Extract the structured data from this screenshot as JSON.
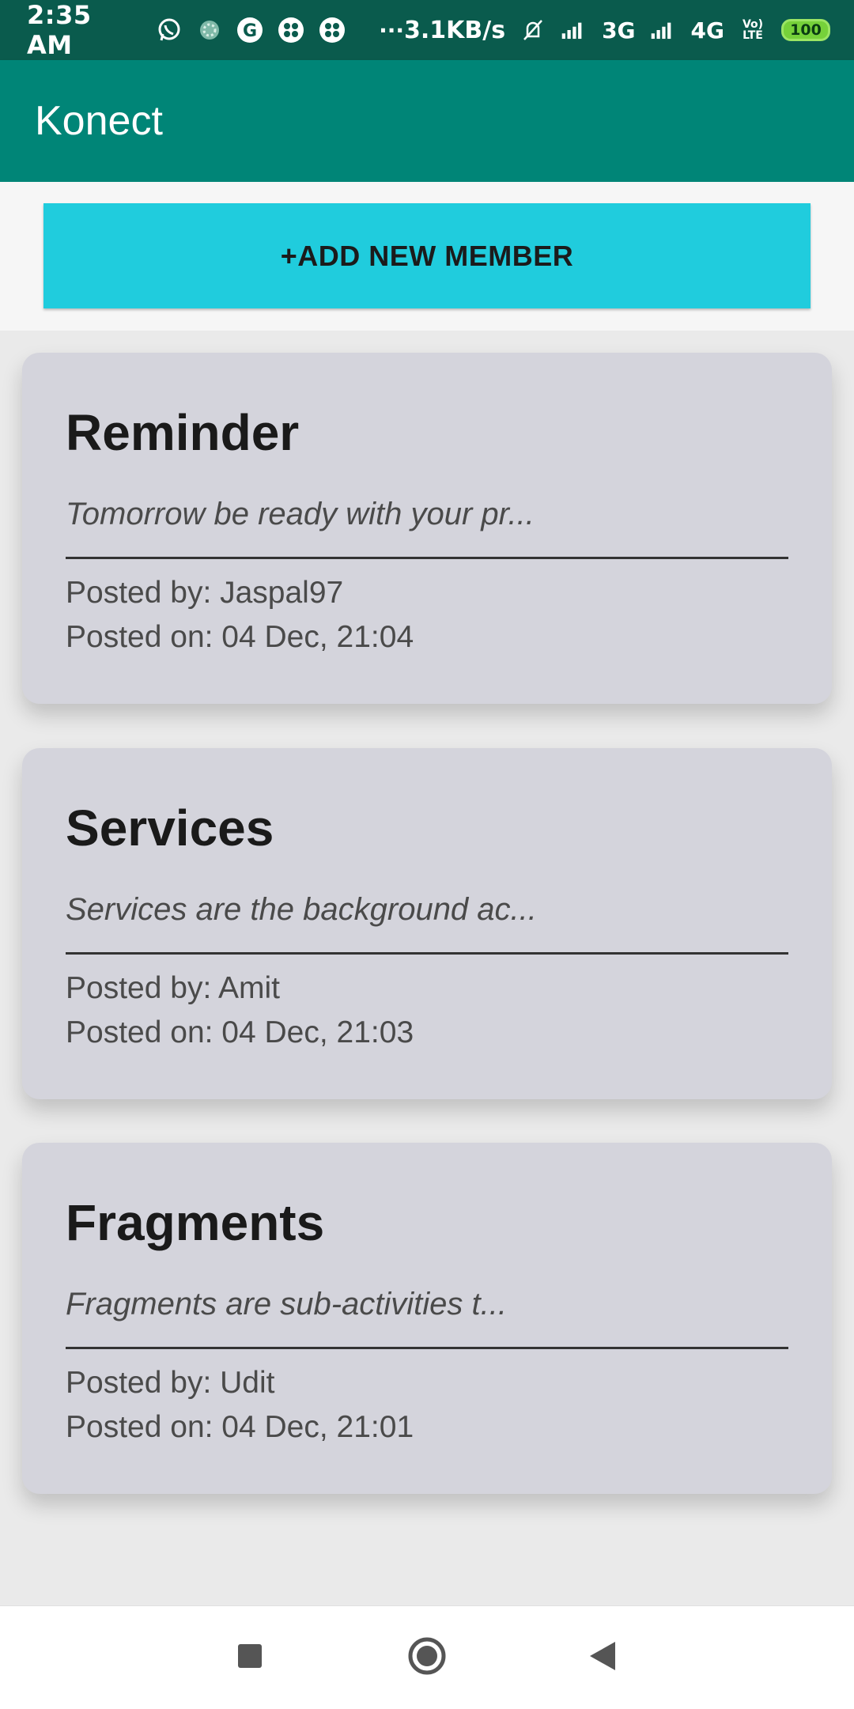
{
  "status_bar": {
    "time": "2:35 AM",
    "speed": "3.1KB/s",
    "net1": "3G",
    "net2": "4G",
    "volte": "Vo) LTE",
    "battery": "100",
    "dots": "···"
  },
  "app_bar": {
    "title": "Konect"
  },
  "add_button": {
    "label": "+ADD NEW MEMBER"
  },
  "posts": [
    {
      "title": "Reminder",
      "description": "Tomorrow be ready with your pr...",
      "posted_by": "Posted by: Jaspal97",
      "posted_on": "Posted on: 04 Dec, 21:04"
    },
    {
      "title": "Services",
      "description": "Services are the background ac...",
      "posted_by": "Posted by: Amit",
      "posted_on": "Posted on: 04 Dec, 21:03"
    },
    {
      "title": "Fragments",
      "description": "Fragments are sub-activities t...",
      "posted_by": "Posted by: Udit",
      "posted_on": "Posted on: 04 Dec, 21:01"
    }
  ],
  "colors": {
    "status_bar": "#0a5b4d",
    "app_bar": "#008577",
    "add_button": "#20ccdd",
    "card": "#d4d4dc"
  },
  "icons": [
    "whatsapp-icon",
    "loading-icon",
    "g-icon",
    "apps-icon",
    "apps-icon",
    "more-icon",
    "mute-icon",
    "signal-icon",
    "battery-icon",
    "recents-icon",
    "home-icon",
    "back-icon"
  ]
}
